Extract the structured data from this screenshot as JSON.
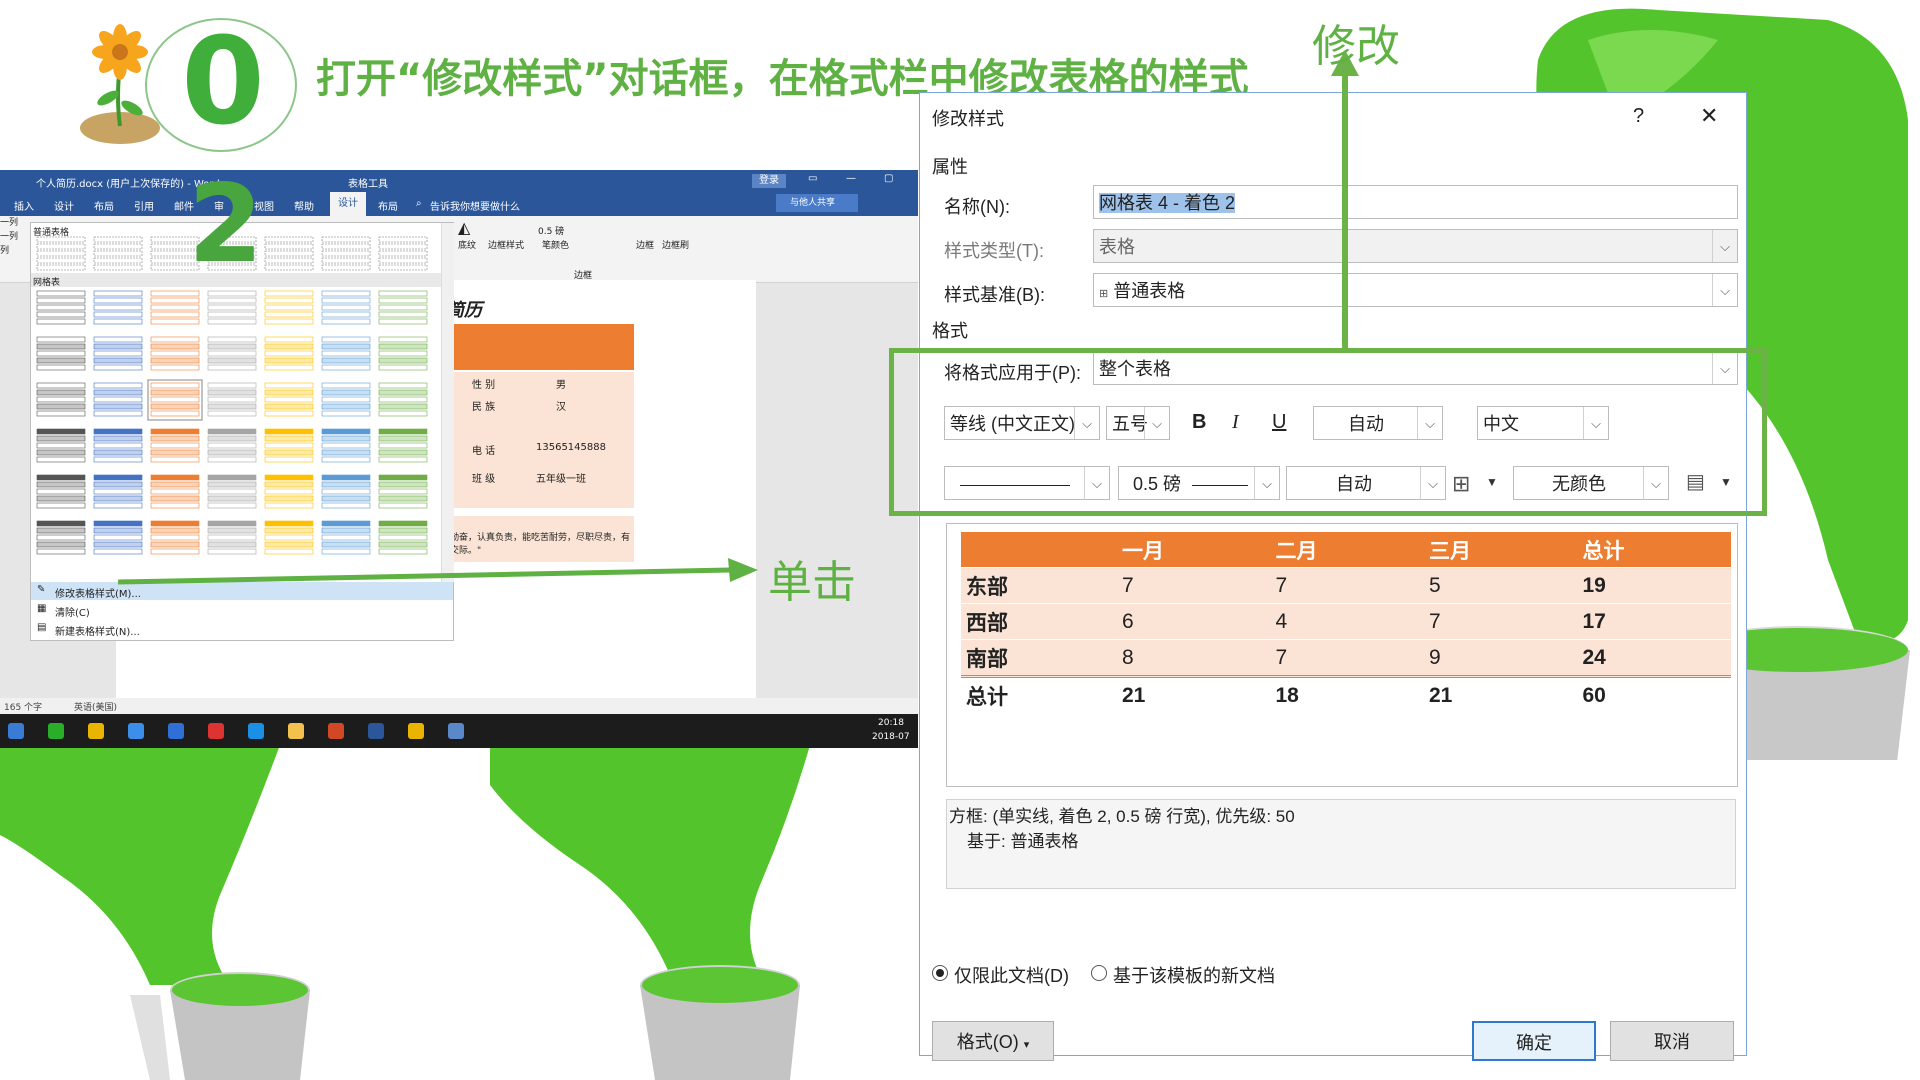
{
  "slide": {
    "step_number": "0",
    "title": "打开“修改样式”对话框，在格式栏中修改表格的样式",
    "annotation_modify": "修改",
    "annotation_click": "单击",
    "step2": "2"
  },
  "word": {
    "title": "个人简历.docx (用户上次保存的) - Word",
    "tools_label": "表格工具",
    "login": "登录",
    "share": "与他人共享",
    "tabs": [
      "插入",
      "设计",
      "布局",
      "引用",
      "邮件",
      "审",
      "视图",
      "帮助",
      "设计",
      "布局"
    ],
    "tell_me": "告诉我你想要做什么",
    "ribbon": {
      "shading": "底纹",
      "border_styles": "边框样式",
      "pen_weight": "0.5 磅",
      "pen_color": "笔颜色",
      "borders": "边框",
      "border_painter": "边框刷",
      "group_borders": "边框"
    },
    "gallery": {
      "section_plain": "普通表格",
      "section_grid": "网格表"
    },
    "menu": [
      "修改表格样式(M)...",
      "清除(C)",
      "新建表格样式(N)..."
    ],
    "left_strip": [
      "一列",
      "一列",
      "列"
    ],
    "doc": {
      "heading": "简历",
      "rows": [
        {
          "label": "性 别",
          "value": "男"
        },
        {
          "label": "民 族",
          "value": "汉"
        },
        {
          "label": "电 话",
          "value": "13565145888"
        },
        {
          "label": "班 级",
          "value": "五年级一班"
        }
      ],
      "quote": "\" 本人性格热情开朗，待人友好，为人诚实谦虚。工作勤奋，认真负责，能吃苦耐劳，尽职尽责，有耐心。具有亲和力，平易近人，善于与人沟通，\" 乐于交际。\""
    },
    "status": {
      "words": "165 个字",
      "lang": "英语(美国)"
    },
    "taskbar": {
      "time": "20:18",
      "date": "2018-07"
    }
  },
  "dialog": {
    "title": "修改样式",
    "help": "?",
    "close": "✕",
    "section_props": "属性",
    "name_label": "名称(N):",
    "name_value": "网格表 4 - 着色 2",
    "type_label": "样式类型(T):",
    "type_value": "表格",
    "base_label": "样式基准(B):",
    "base_value": "普通表格",
    "section_format": "格式",
    "apply_label": "将格式应用于(P):",
    "apply_value": "整个表格",
    "font": "等线 (中文正文)",
    "size": "五号",
    "bold": "B",
    "italic": "I",
    "underline": "U",
    "color": "自动",
    "script": "中文",
    "border_weight": "0.5 磅",
    "border_color": "自动",
    "shading": "无颜色",
    "preview": {
      "header": [
        "",
        "一月",
        "二月",
        "三月",
        "总计"
      ],
      "rows": [
        [
          "东部",
          "7",
          "7",
          "5",
          "19"
        ],
        [
          "西部",
          "6",
          "4",
          "7",
          "17"
        ],
        [
          "南部",
          "8",
          "7",
          "9",
          "24"
        ]
      ],
      "total": [
        "总计",
        "21",
        "18",
        "21",
        "60"
      ]
    },
    "description_line1": "方框: (单实线, 着色 2,  0.5 磅 行宽), 优先级: 50",
    "description_line2": "基于: 普通表格",
    "radio_doc": "仅限此文档(D)",
    "radio_template": "基于该模板的新文档",
    "format_button": "格式(O)",
    "ok": "确定",
    "cancel": "取消"
  },
  "colors": {
    "accent_green": "#5fb144",
    "orange_header": "#ed7d31",
    "orange_light": "#fbe4d5",
    "word_blue": "#2b579a"
  }
}
